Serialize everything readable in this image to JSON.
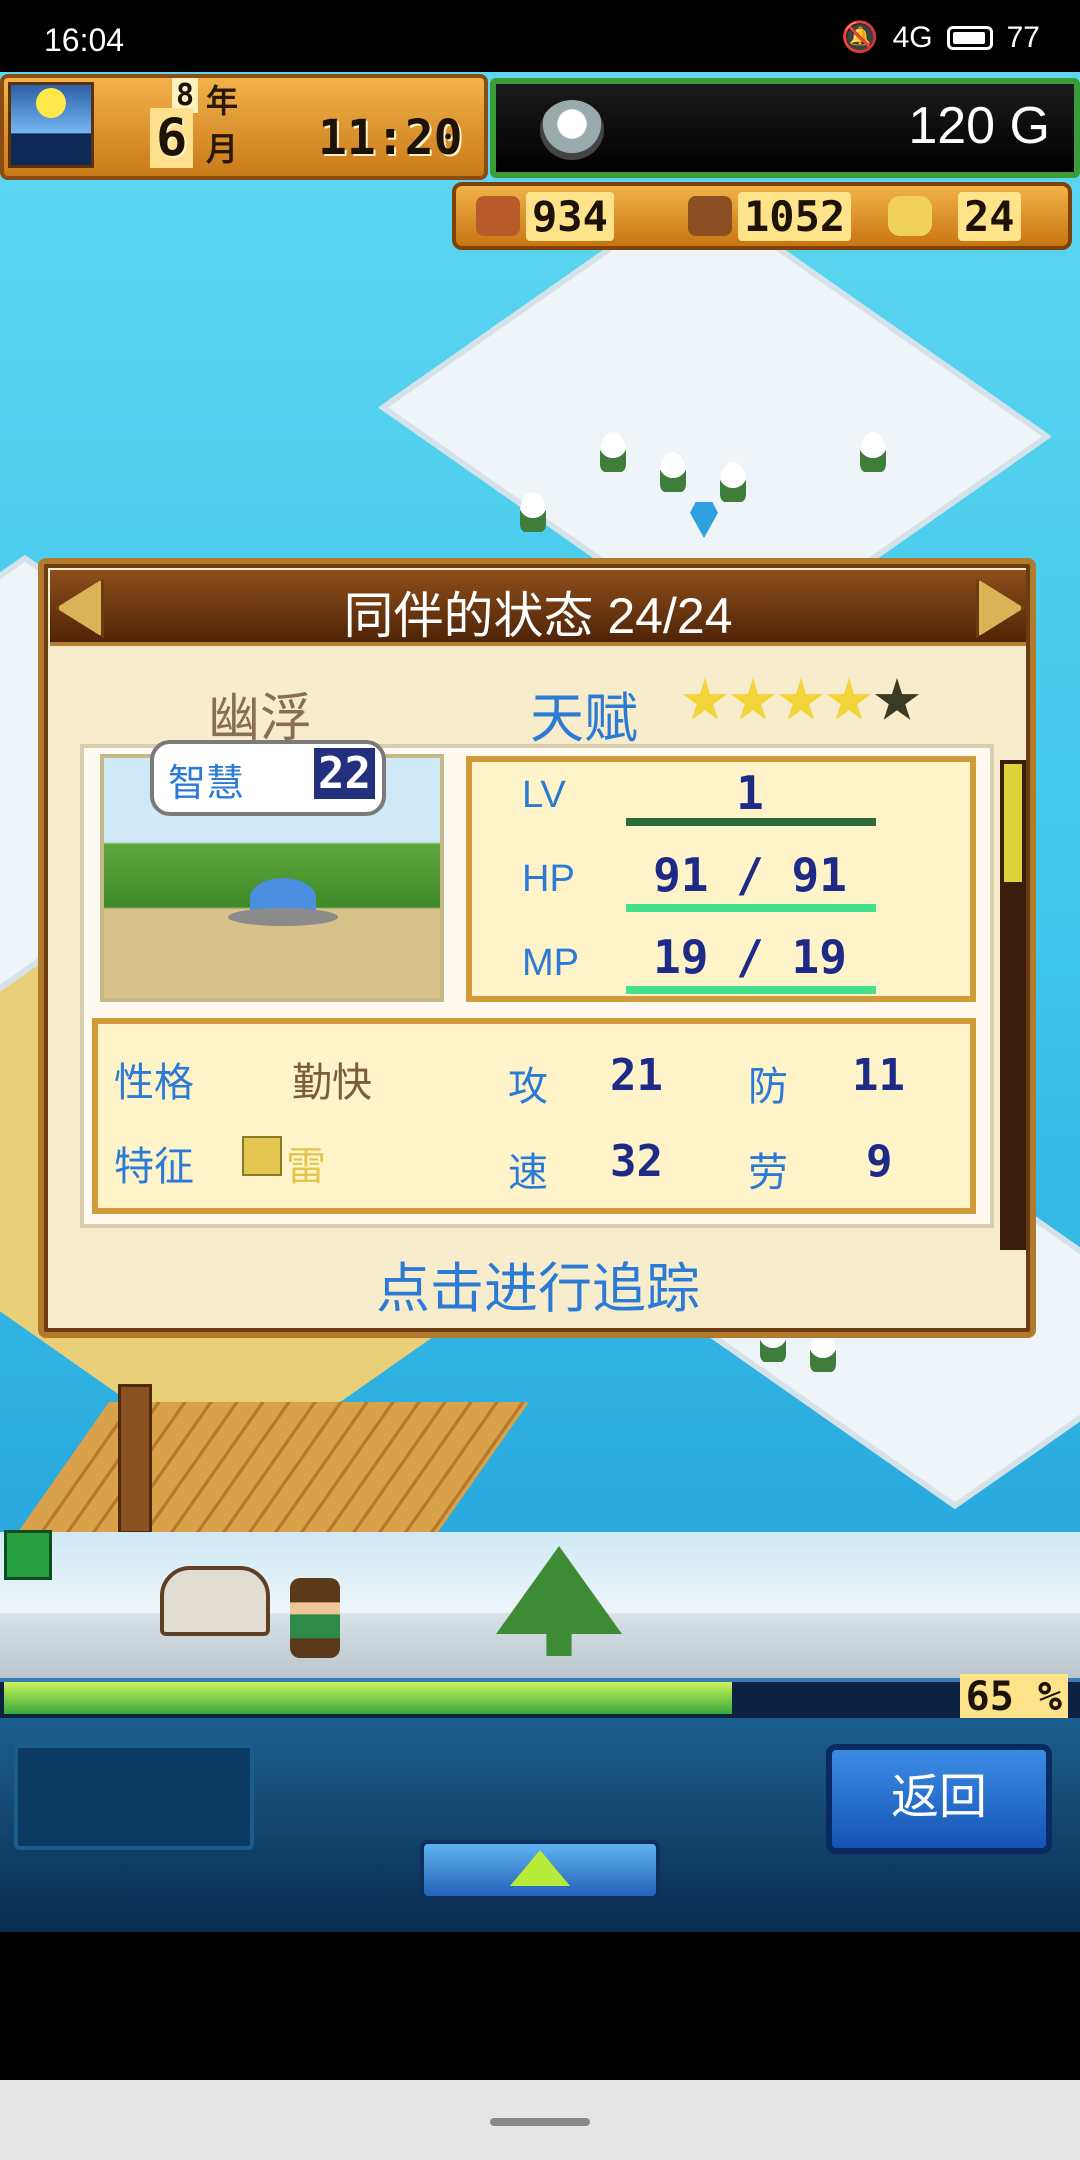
{
  "status_bar": {
    "time": "16:04",
    "network": "4G",
    "battery": "77"
  },
  "header": {
    "year_num": "8",
    "year_label": "年",
    "month_num": "6",
    "month_label": "月",
    "clock": "11:20",
    "gold": "120 G"
  },
  "resources": {
    "meat": "934",
    "wood": "1052",
    "medal": "24"
  },
  "panel": {
    "title": "同伴的状态 24/24",
    "companion_name": "幽浮",
    "talent_label": "天赋",
    "stars_filled": 4,
    "stars_total": 5,
    "wisdom_label": "智慧",
    "wisdom_value": "22",
    "stats": {
      "lv_label": "LV",
      "lv_value": "1",
      "hp_label": "HP",
      "hp_value": "91 / 91",
      "mp_label": "MP",
      "mp_value": "19 / 19"
    },
    "attributes": {
      "personality_label": "性格",
      "personality_value": "勤快",
      "trait_label": "特征",
      "trait_value": "雷",
      "atk_label": "攻",
      "atk_value": "21",
      "def_label": "防",
      "def_value": "11",
      "spd_label": "速",
      "spd_value": "32",
      "labor_label": "劳",
      "labor_value": "9"
    },
    "track_button": "点击进行追踪"
  },
  "progress": {
    "percent": 65,
    "label": "65 %"
  },
  "controls": {
    "back_label": "返回"
  },
  "colors": {
    "accent_blue": "#2b7bd6",
    "panel_brown": "#6b3b12",
    "cream": "#f7eccb"
  },
  "icons": [
    "mute-icon",
    "signal-icon",
    "battery-icon",
    "sun-icon",
    "coin-icon",
    "meat-icon",
    "wood-icon",
    "medal-icon",
    "arrow-left-icon",
    "arrow-right-icon",
    "star-icon",
    "ufo-icon",
    "thunder-icon",
    "figure-icon",
    "up-arrow-icon"
  ]
}
